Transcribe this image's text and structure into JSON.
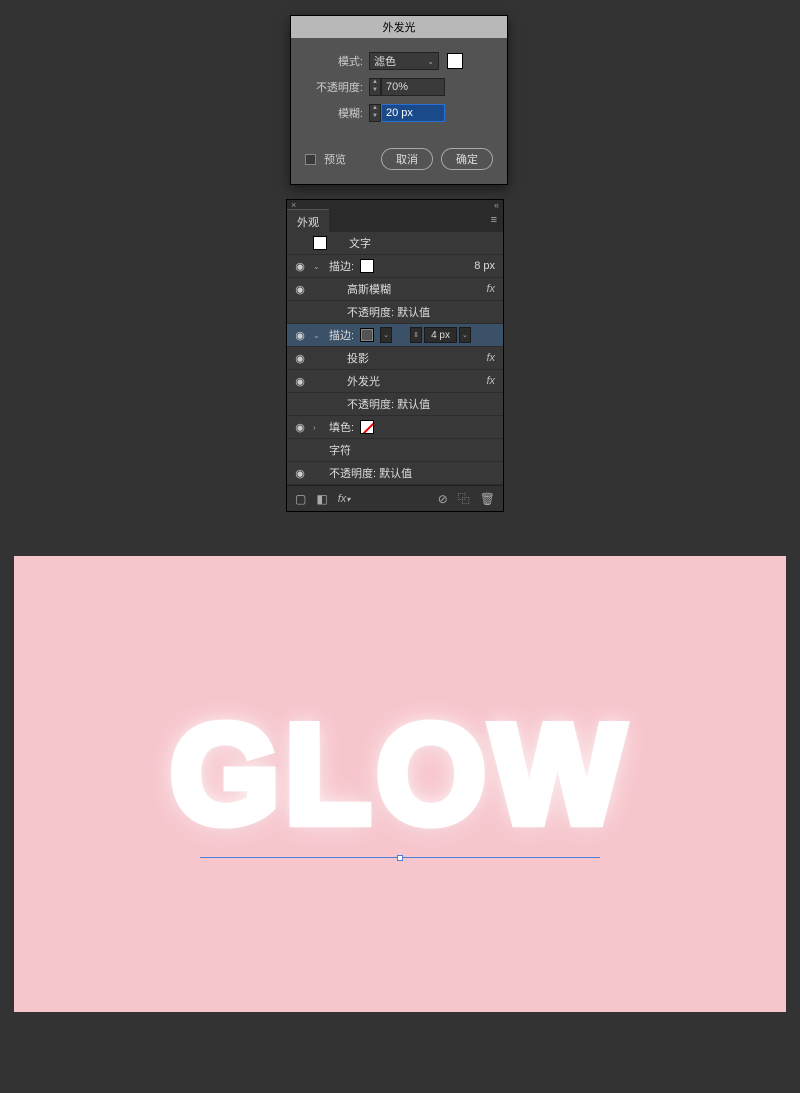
{
  "dialog": {
    "title": "外发光",
    "mode_label": "模式:",
    "mode_value": "滤色",
    "opacity_label": "不透明度:",
    "opacity_value": "70%",
    "blur_label": "模糊:",
    "blur_value": "20 px",
    "preview_label": "预览",
    "cancel": "取消",
    "ok": "确定"
  },
  "panel": {
    "tab": "外观",
    "type_row": "文字",
    "rows": {
      "stroke1": {
        "label": "描边:",
        "size": "8 px"
      },
      "gauss": "高斯模糊",
      "opacity_default1": "不透明度: 默认值",
      "stroke2": {
        "label": "描边:",
        "size": "4 px"
      },
      "shadow": "投影",
      "outer_glow": "外发光",
      "opacity_default2": "不透明度: 默认值",
      "fill": "填色:",
      "char": "字符",
      "opacity_default3": "不透明度: 默认值"
    },
    "fx_lbl": "fx"
  },
  "canvas": {
    "text": "GLOW"
  }
}
